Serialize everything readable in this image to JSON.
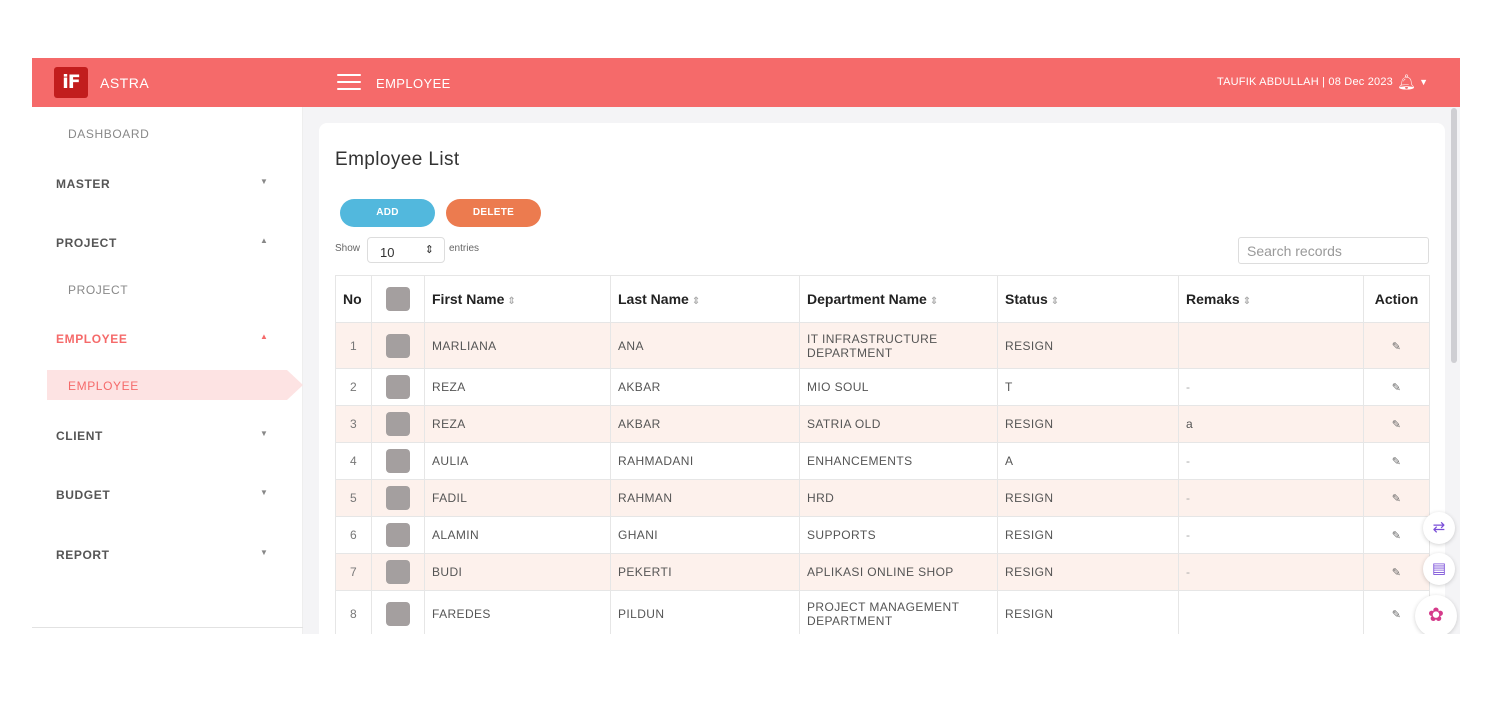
{
  "header": {
    "brand": "ASTRA",
    "logo_text": "iF",
    "page": "EMPLOYEE",
    "user_info": "TAUFIK ABDULLAH | 08 Dec 2023"
  },
  "sidebar": {
    "items": [
      {
        "label": "DASHBOARD"
      },
      {
        "label": "MASTER"
      },
      {
        "label": "PROJECT"
      },
      {
        "label": "PROJECT"
      },
      {
        "label": "EMPLOYEE"
      },
      {
        "label": "EMPLOYEE"
      },
      {
        "label": "CLIENT"
      },
      {
        "label": "BUDGET"
      },
      {
        "label": "REPORT"
      }
    ]
  },
  "main": {
    "title": "Employee List",
    "add_label": "ADD",
    "delete_label": "DELETE",
    "show_label": "Show",
    "show_value": "10",
    "entries_label": "entries",
    "search_placeholder": "Search records"
  },
  "table": {
    "columns": [
      "No",
      "First Name",
      "Last Name",
      "Department Name",
      "Status",
      "Remaks",
      "Action"
    ],
    "rows": [
      {
        "no": "1",
        "first": "MARLIANA",
        "last": "ANA",
        "dept": "IT INFRASTRUCTURE DEPARTMENT",
        "status": "RESIGN",
        "remarks": ""
      },
      {
        "no": "2",
        "first": "REZA",
        "last": "AKBAR",
        "dept": "MIO SOUL",
        "status": "T",
        "remarks": "-"
      },
      {
        "no": "3",
        "first": "REZA",
        "last": "AKBAR",
        "dept": "SATRIA OLD",
        "status": "RESIGN",
        "remarks": "a"
      },
      {
        "no": "4",
        "first": "AULIA",
        "last": "RAHMADANI",
        "dept": "ENHANCEMENTS",
        "status": "A",
        "remarks": "-"
      },
      {
        "no": "5",
        "first": "FADIL",
        "last": "RAHMAN",
        "dept": "HRD",
        "status": "RESIGN",
        "remarks": "-"
      },
      {
        "no": "6",
        "first": "ALAMIN",
        "last": "GHANI",
        "dept": "SUPPORTS",
        "status": "RESIGN",
        "remarks": "-"
      },
      {
        "no": "7",
        "first": "BUDI",
        "last": "PEKERTI",
        "dept": "APLIKASI ONLINE SHOP",
        "status": "RESIGN",
        "remarks": "-"
      },
      {
        "no": "8",
        "first": "FAREDES",
        "last": "PILDUN",
        "dept": "PROJECT MANAGEMENT DEPARTMENT",
        "status": "RESIGN",
        "remarks": ""
      }
    ]
  },
  "icons": {
    "menu": "hamburger-icon",
    "bell": "bell-icon",
    "edit": "edit-icon",
    "translate": "translate-icon",
    "reader": "book-icon",
    "assistant": "brain-icon"
  },
  "colors": {
    "topbar": "#f56a6a",
    "logo": "#c21d1d",
    "add": "#52b8dd",
    "delete": "#ec7b4f",
    "row_stripe": "#fdf1ec",
    "active": "#f56a6a"
  }
}
